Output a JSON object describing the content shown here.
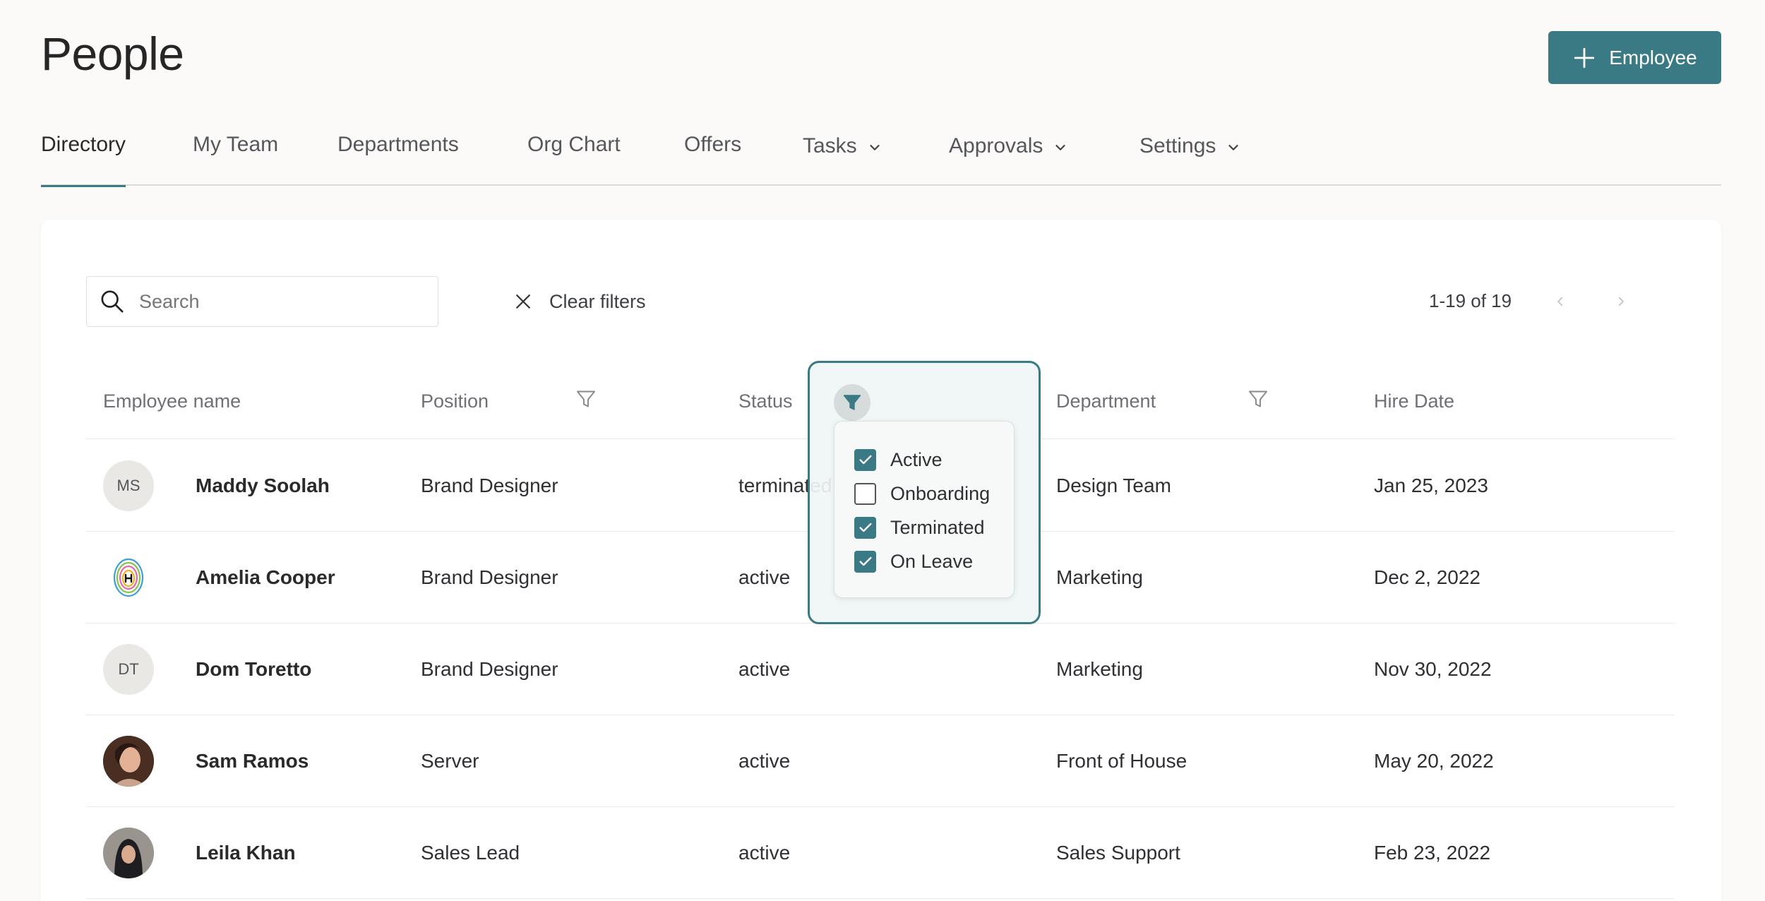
{
  "header": {
    "title": "People",
    "add_button_label": "Employee"
  },
  "tabs": [
    {
      "label": "Directory",
      "active": true,
      "dropdown": false
    },
    {
      "label": "My Team",
      "active": false,
      "dropdown": false
    },
    {
      "label": "Departments",
      "active": false,
      "dropdown": false
    },
    {
      "label": "Org Chart",
      "active": false,
      "dropdown": false
    },
    {
      "label": "Offers",
      "active": false,
      "dropdown": false
    },
    {
      "label": "Tasks",
      "active": false,
      "dropdown": true
    },
    {
      "label": "Approvals",
      "active": false,
      "dropdown": true
    },
    {
      "label": "Settings",
      "active": false,
      "dropdown": true
    }
  ],
  "toolbar": {
    "search_placeholder": "Search",
    "clear_filters_label": "Clear filters",
    "pagination": "1-19 of 19"
  },
  "table": {
    "columns": {
      "name": "Employee name",
      "position": "Position",
      "status": "Status",
      "department": "Department",
      "hire_date": "Hire Date"
    },
    "rows": [
      {
        "initials": "MS",
        "avatar_type": "initials",
        "name": "Maddy Soolah",
        "position": "Brand Designer",
        "status": "terminated",
        "department": "Design Team",
        "hire_date": "Jan 25, 2023"
      },
      {
        "initials": "",
        "avatar_type": "logo",
        "name": "Amelia Cooper",
        "position": "Brand Designer",
        "status": "active",
        "department": "Marketing",
        "hire_date": "Dec 2, 2022"
      },
      {
        "initials": "DT",
        "avatar_type": "initials",
        "name": "Dom Toretto",
        "position": "Brand Designer",
        "status": "active",
        "department": "Marketing",
        "hire_date": "Nov 30, 2022"
      },
      {
        "initials": "",
        "avatar_type": "photo",
        "name": "Sam Ramos",
        "position": "Server",
        "status": "active",
        "department": "Front of House",
        "hire_date": "May 20, 2022"
      },
      {
        "initials": "",
        "avatar_type": "photo",
        "name": "Leila Khan",
        "position": "Sales Lead",
        "status": "active",
        "department": "Sales Support",
        "hire_date": "Feb 23, 2022"
      }
    ]
  },
  "status_filter": {
    "options": [
      {
        "label": "Active",
        "checked": true
      },
      {
        "label": "Onboarding",
        "checked": false
      },
      {
        "label": "Terminated",
        "checked": true
      },
      {
        "label": "On Leave",
        "checked": true
      }
    ]
  },
  "colors": {
    "accent": "#3a7a85",
    "background": "#fbfaf8",
    "card": "#ffffff"
  }
}
